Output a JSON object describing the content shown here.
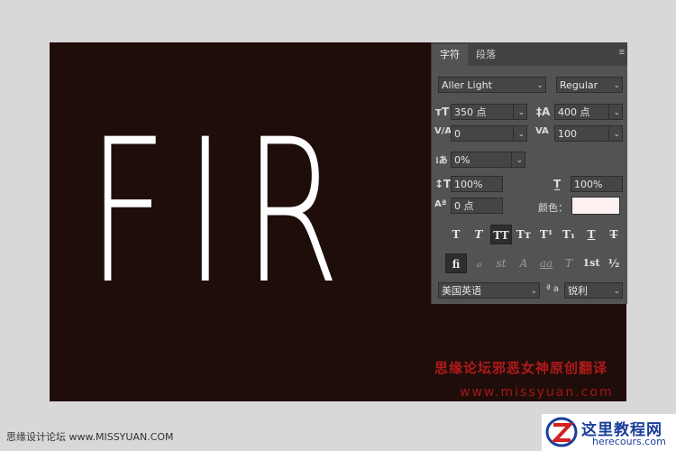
{
  "canvas": {
    "big_text": "FIR",
    "watermark_cn": "思缘论坛邪恶女神原创翻译",
    "watermark_url": "www.missyuan.com"
  },
  "panel": {
    "tabs": [
      "字符",
      "段落"
    ],
    "font_family": "Aller Light",
    "font_style": "Regular",
    "font_size": "350 点",
    "leading": "400 点",
    "kerning": "0",
    "tracking": "100",
    "vertical_scale": "0%",
    "vert_scale_pct": "100%",
    "horiz_scale_pct": "100%",
    "baseline_shift": "0 点",
    "color_label": "颜色：",
    "color_value": "#fcf0f0",
    "style_buttons": [
      "T",
      "T",
      "TT",
      "Tт",
      "T¹",
      "T₁",
      "T",
      "T"
    ],
    "opentype_buttons": [
      "fi",
      "ℴ",
      "st",
      "A",
      "aa",
      "T",
      "1st",
      "½"
    ],
    "language": "美国英语",
    "aa_label": "ª a",
    "antialias": "锐利"
  },
  "footer": {
    "left_text": "思缘设计论坛 www.MISSYUAN.COM",
    "logo_cn": "这里教程网",
    "logo_url": "herecours.com"
  }
}
